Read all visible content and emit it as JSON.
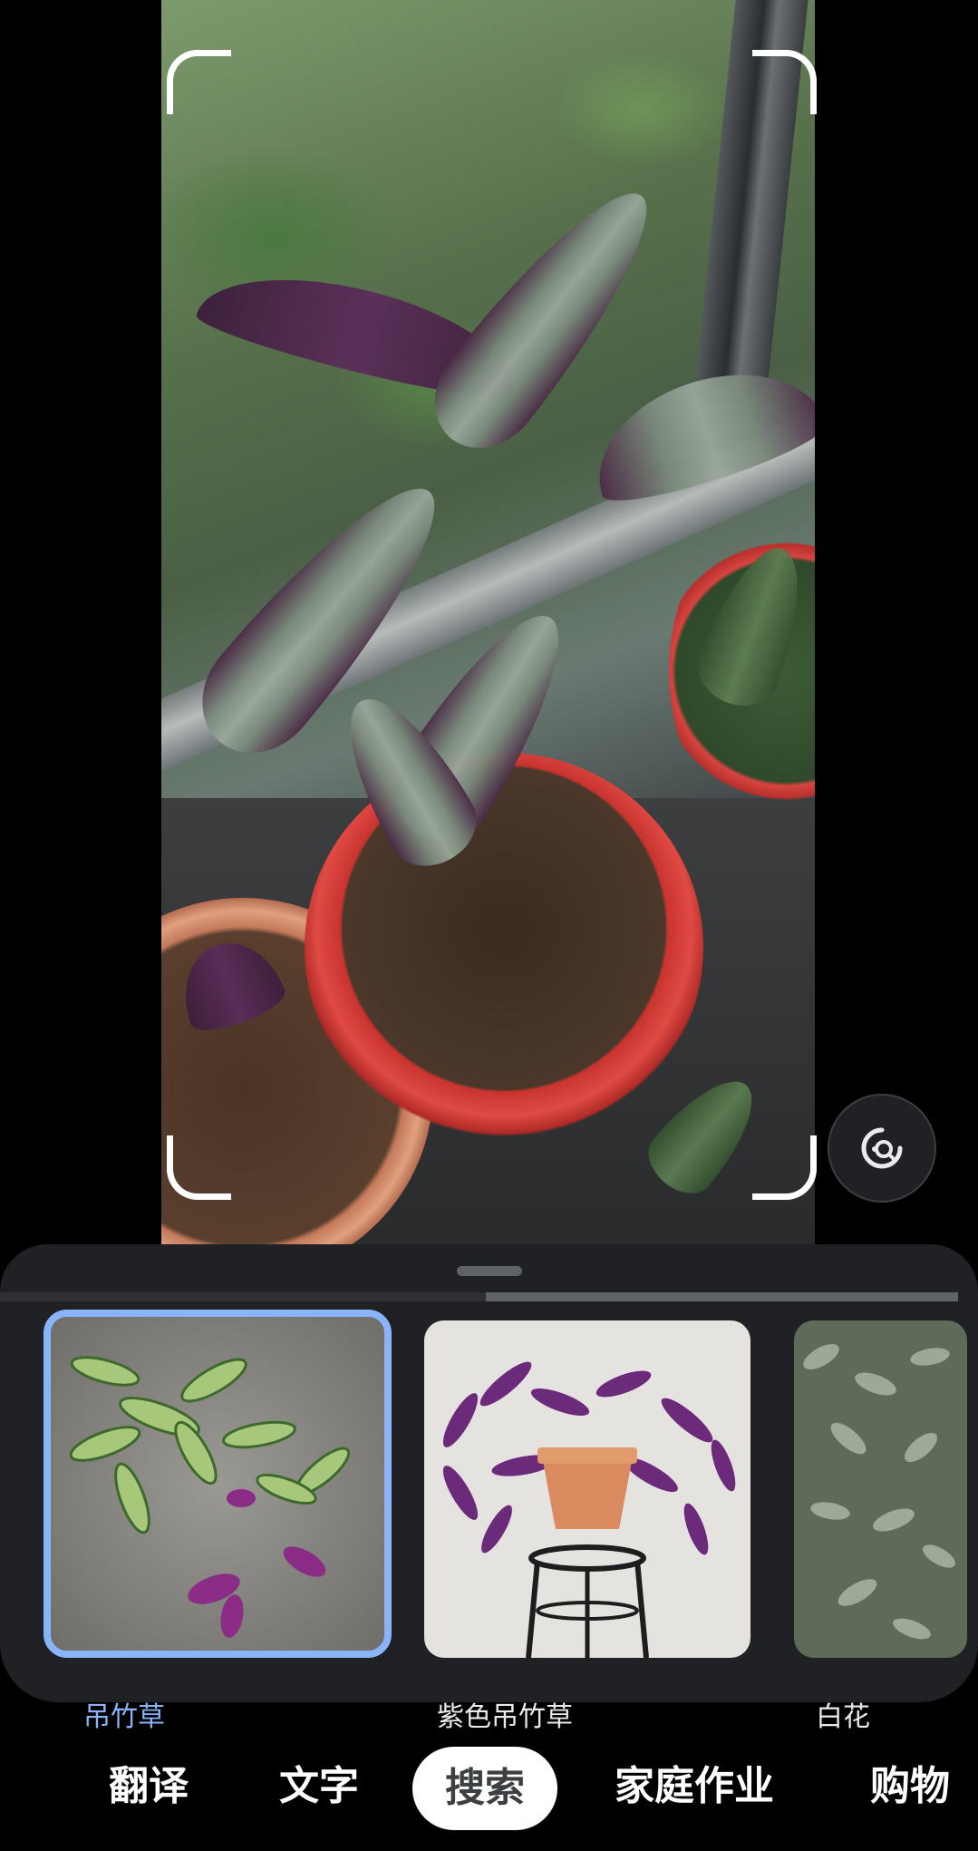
{
  "viewfinder": {
    "lens_button_icon": "lens-search-icon"
  },
  "results": {
    "items": [
      {
        "label": "吊竹草",
        "selected": true
      },
      {
        "label": "紫色吊竹草",
        "selected": false
      },
      {
        "label": "白花",
        "selected": false
      }
    ]
  },
  "modes": [
    {
      "label": "翻译",
      "active": false
    },
    {
      "label": "文字",
      "active": false
    },
    {
      "label": "搜索",
      "active": true
    },
    {
      "label": "家庭作业",
      "active": false
    },
    {
      "label": "购物",
      "active": false
    }
  ],
  "colors": {
    "accent": "#8ab4f8",
    "sheet_bg": "#202124",
    "chip_active_bg": "#ffffff"
  }
}
